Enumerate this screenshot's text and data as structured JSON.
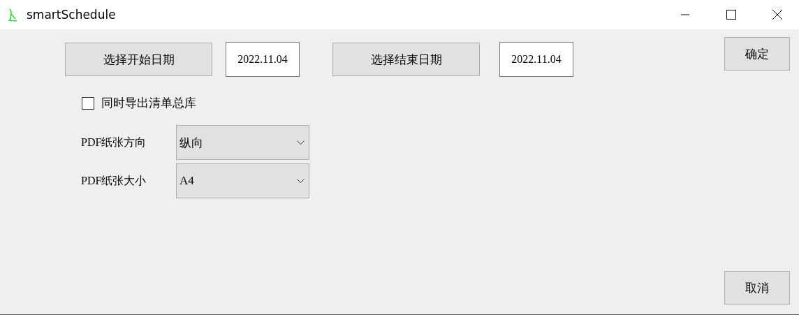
{
  "window": {
    "title": "smartSchedule"
  },
  "start": {
    "button": "选择开始日期",
    "date": "2022.11.04"
  },
  "end": {
    "button": "选择结束日期",
    "date": "2022.11.04"
  },
  "export_option": {
    "label": "同时导出清单总库",
    "checked": false
  },
  "settings": [
    {
      "label": "PDF纸张方向",
      "value": "纵向"
    },
    {
      "label": "PDF纸张大小",
      "value": "A4"
    }
  ],
  "confirm_button": "确定",
  "cancel_button": "取消"
}
